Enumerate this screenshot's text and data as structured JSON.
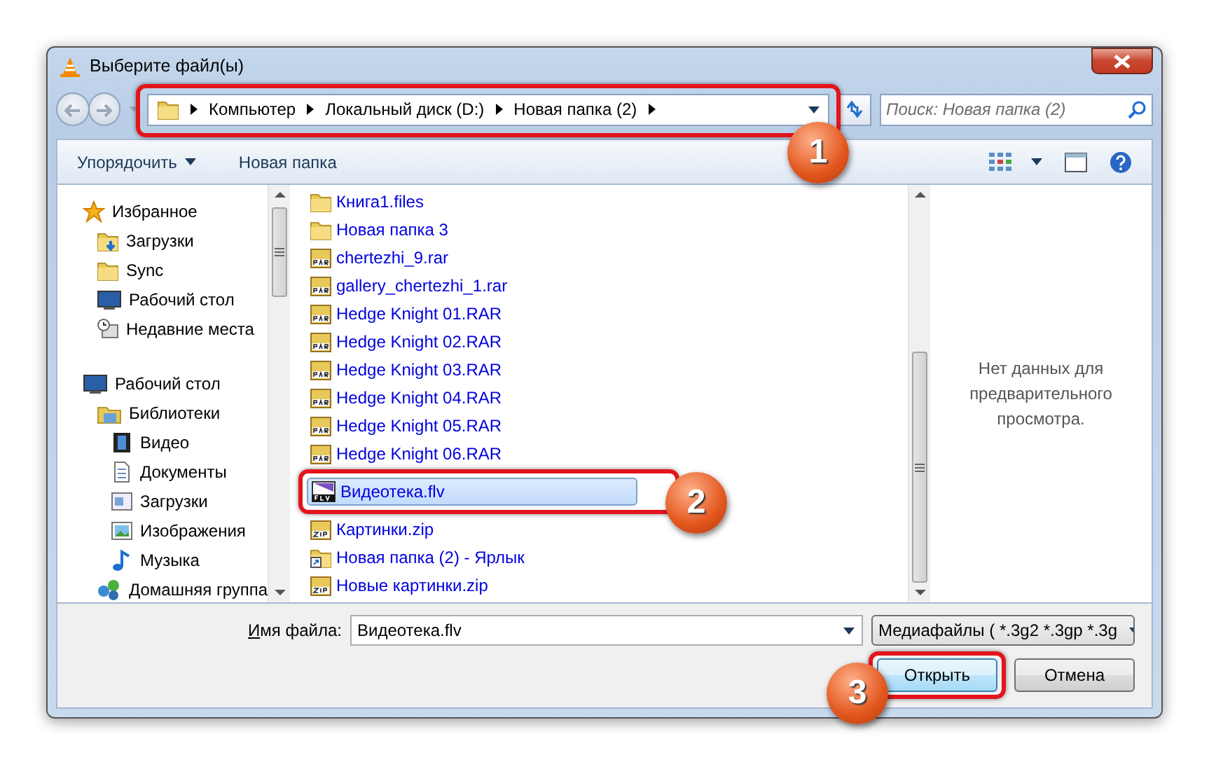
{
  "window": {
    "title": "Выберите файл(ы)"
  },
  "address_bar": {
    "crumbs": [
      "Компьютер",
      "Локальный диск (D:)",
      "Новая папка (2)"
    ],
    "annotation": "1"
  },
  "search": {
    "placeholder": "Поиск: Новая папка (2)"
  },
  "toolbar": {
    "organize": "Упорядочить",
    "new_folder": "Новая папка"
  },
  "navigation": [
    {
      "label": "Избранное",
      "kind": "star",
      "children": [
        {
          "label": "Загрузки",
          "kind": "downloads"
        },
        {
          "label": "Sync",
          "kind": "folder"
        },
        {
          "label": "Рабочий стол",
          "kind": "desktop"
        },
        {
          "label": "Недавние места",
          "kind": "recent"
        }
      ]
    },
    {
      "label": "Рабочий стол",
      "kind": "desktop",
      "children": [
        {
          "label": "Библиотеки",
          "kind": "library",
          "children": [
            {
              "label": "Видео",
              "kind": "video"
            },
            {
              "label": "Документы",
              "kind": "document"
            },
            {
              "label": "Загрузки",
              "kind": "window"
            },
            {
              "label": "Изображения",
              "kind": "image"
            },
            {
              "label": "Музыка",
              "kind": "music"
            }
          ]
        },
        {
          "label": "Домашняя группа",
          "kind": "homegroup"
        }
      ]
    }
  ],
  "files": [
    {
      "name": "Книга1.files",
      "kind": "folder",
      "selected": false
    },
    {
      "name": "Новая папка 3",
      "kind": "folder",
      "selected": false
    },
    {
      "name": "chertezhi_9.rar",
      "kind": "rar",
      "selected": false
    },
    {
      "name": "gallery_chertezhi_1.rar",
      "kind": "rar",
      "selected": false
    },
    {
      "name": "Hedge Knight 01.RAR",
      "kind": "rar",
      "selected": false
    },
    {
      "name": "Hedge Knight 02.RAR",
      "kind": "rar",
      "selected": false
    },
    {
      "name": "Hedge Knight 03.RAR",
      "kind": "rar",
      "selected": false
    },
    {
      "name": "Hedge Knight 04.RAR",
      "kind": "rar",
      "selected": false
    },
    {
      "name": "Hedge Knight 05.RAR",
      "kind": "rar",
      "selected": false
    },
    {
      "name": "Hedge Knight 06.RAR",
      "kind": "rar",
      "selected": false
    },
    {
      "name": "Видеотека.flv",
      "kind": "flv",
      "selected": true,
      "annotation": "2"
    },
    {
      "name": "Картинки.zip",
      "kind": "zip",
      "selected": false
    },
    {
      "name": "Новая папка (2) - Ярлык",
      "kind": "shortcut",
      "selected": false
    },
    {
      "name": "Новые картинки.zip",
      "kind": "zip",
      "selected": false
    }
  ],
  "preview": {
    "message": "Нет данных для предварительного просмотра."
  },
  "file_name": {
    "label": "Имя файла:",
    "value": "Видеотека.flv"
  },
  "filter": {
    "value": "Медиафайлы ( *.3g2 *.3gp *.3g"
  },
  "buttons": {
    "open": "Открыть",
    "open_annotation": "3",
    "cancel": "Отмена"
  }
}
